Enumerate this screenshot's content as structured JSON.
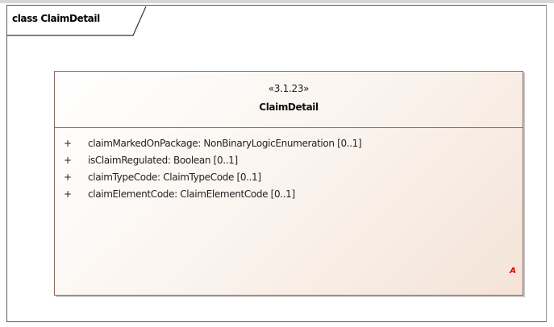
{
  "frame": {
    "title": "class ClaimDetail"
  },
  "class": {
    "stereotype": "«3.1.23»",
    "name": "ClaimDetail",
    "attributes": [
      {
        "visibility": "+",
        "text": "claimMarkedOnPackage: NonBinaryLogicEnumeration [0..1]"
      },
      {
        "visibility": "+",
        "text": "isClaimRegulated: Boolean [0..1]"
      },
      {
        "visibility": "+",
        "text": "claimTypeCode: ClaimTypeCode [0..1]"
      },
      {
        "visibility": "+",
        "text": "claimElementCode: ClaimElementCode [0..1]"
      }
    ],
    "marker": "A"
  },
  "colors": {
    "frame_border": "#5a5a5a",
    "class_border": "#8a6a60",
    "class_fill_start": "#ffffff",
    "class_fill_end": "#f4e3d7",
    "marker": "#e00000"
  }
}
